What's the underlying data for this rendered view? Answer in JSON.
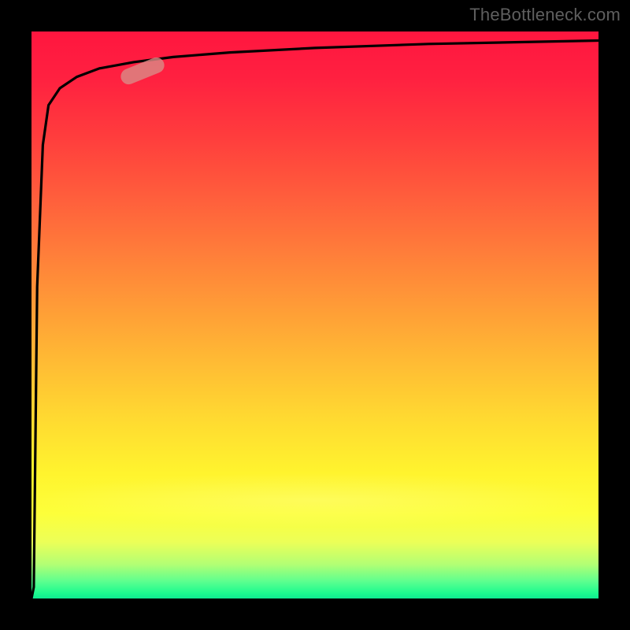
{
  "watermark": "TheBottleneck.com",
  "chart_data": {
    "type": "line",
    "title": "",
    "xlabel": "",
    "ylabel": "",
    "xlim": [
      0,
      100
    ],
    "ylim": [
      0,
      100
    ],
    "grid": false,
    "legend": false,
    "annotations": [
      {
        "kind": "highlight-pill",
        "x": 22,
        "y": 94,
        "angle_deg": -22,
        "color": "#d98b86"
      }
    ],
    "background_gradient": {
      "direction": "vertical",
      "stops": [
        {
          "pos": 0.0,
          "color": "#ff163f"
        },
        {
          "pos": 0.5,
          "color": "#ff9a37"
        },
        {
          "pos": 0.8,
          "color": "#fff42e"
        },
        {
          "pos": 1.0,
          "color": "#0eea90"
        }
      ]
    },
    "series": [
      {
        "name": "curve",
        "color": "#000000",
        "x": [
          0,
          0.4,
          1,
          2,
          3,
          5,
          8,
          12,
          18,
          25,
          35,
          50,
          70,
          100
        ],
        "y": [
          0,
          2,
          55,
          80,
          87,
          90,
          92,
          93.5,
          94.6,
          95.5,
          96.3,
          97.1,
          97.8,
          98.4
        ]
      }
    ]
  }
}
